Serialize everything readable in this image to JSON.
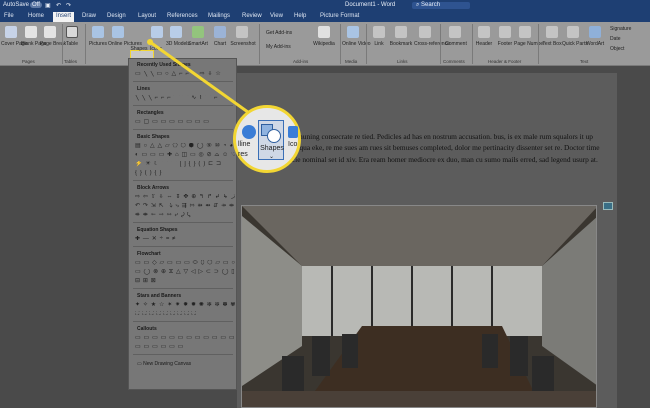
{
  "titlebar": {
    "autosave_label": "AutoSave",
    "autosave_state": "Off",
    "doc_title": "Document1 - Word",
    "search_placeholder": "Search"
  },
  "tabs": [
    "File",
    "Home",
    "Insert",
    "Draw",
    "Design",
    "Layout",
    "References",
    "Mailings",
    "Review",
    "View",
    "Help",
    "Picture Format"
  ],
  "ribbon": {
    "pages": {
      "cover": "Cover Page",
      "blank": "Blank Page",
      "break": "Page Break",
      "group": "Pages"
    },
    "tables": {
      "table": "Table",
      "group": "Tables"
    },
    "illustrations": {
      "pictures": "Pictures",
      "online": "Online Pictures",
      "shapes": "Shapes",
      "icons": "Icons",
      "models": "3D Models",
      "smartart": "SmartArt",
      "chart": "Chart",
      "screenshot": "Screenshot"
    },
    "addins": {
      "get": "Get Add-ins",
      "my": "My Add-ins",
      "wikipedia": "Wikipedia",
      "group": "Add-ins"
    },
    "media": {
      "online_video": "Online Video",
      "group": "Media"
    },
    "links": {
      "link": "Link",
      "bookmark": "Bookmark",
      "cross": "Cross-reference",
      "group": "Links"
    },
    "comments": {
      "comment": "Comment",
      "group": "Comments"
    },
    "header_footer": {
      "header": "Header",
      "footer": "Footer",
      "page_number": "Page Number",
      "group": "Header & Footer"
    },
    "text": {
      "textbox": "Text Box",
      "quick": "Quick Parts",
      "wordart": "WordArt",
      "signature": "Signature",
      "date": "Date",
      "object": "Object",
      "group": "Text"
    }
  },
  "shapes_panel": {
    "sections": [
      {
        "title": "Recently Used Shapes",
        "rows": [
          "▭ ╲ ╲ ▭ ○ △ ⌐ ⌐ ↘ ⇨ ⇩ ☆"
        ]
      },
      {
        "title": "Lines",
        "rows": [
          "╲ ╲ ╲ ⌐ ⌐ ⌐ ⌒ ⌒ ∿ ⌇ ⌒ ⌐"
        ]
      },
      {
        "title": "Rectangles",
        "rows": [
          "▭ ▢ ▭ ▭ ▭ ▭ ▭ ▭ ▭"
        ]
      },
      {
        "title": "Basic Shapes",
        "rows": [
          "▤ ○ △ △ ▱ ⬠ ⬡ ⬢ ◯ ⑨ ⑩ ◔ ◕",
          "◐ ▭ ▭ ▭ ✚ ⌂ ◫ ▭ ◎ ⊘ ⌓ ☺ ♡",
          "⚡ ☀ ☾ ⌒ ⌒ [ ] { } ( ) ⊏ ⊐",
          "{ } ( ) { }"
        ]
      },
      {
        "title": "Block Arrows",
        "rows": [
          "⇨ ⇦ ⇧ ⇩ ⇔ ⇕ ✥ ⊕ ↰ ↱ ↲ ↳ ⤴",
          "↶ ↷ ⇲ ⇱ ⤵ ⤷ ⇶ ⇰ ⇻ ⇴ ⇵ ⇸ ⇹",
          "⇺ ⇼ ⇽ ⇾ ⇿ ⤶ ⤸ ⤹"
        ]
      },
      {
        "title": "Equation Shapes",
        "rows": [
          "✚ — ✕ ÷ = ≠"
        ]
      },
      {
        "title": "Flowchart",
        "rows": [
          "▭ ▭ ◇ ▱ ▭ ▭ ▭ ⬭ ⬯ ⬡ ▱ ▭ ○",
          "▭ ◯ ⊗ ⊕ ⧖ △ ▽ ◁ ▷ ⊂ ⊃ ◯ ▯",
          "⊟ ⊞ ⊠"
        ]
      },
      {
        "title": "Stars and Banners",
        "rows": [
          "✦ ✧ ★ ☆ ✶ ✷ ✸ ✹ ✺ ✻ ✼ ✽ ✾",
          "⛶ ⛶ ⛶ ⛶ ⛶ ⛶ ⛶ ⛶ ⛶"
        ]
      },
      {
        "title": "Callouts",
        "rows": [
          "▭ ▭ ▭ ▭ ▭ ▭ ▭ ▭ ▭ ▭ ▭ ▭ ▭",
          "▭ ▭ ▭ ▭ ▭ ▭"
        ]
      }
    ],
    "new_canvas": "New Drawing Canvas"
  },
  "callout": {
    "icon_left": "lline",
    "shapes_label": "Shapes",
    "text_left": "res",
    "text_right": "Ico"
  },
  "document": {
    "paragraph": "sits mate is, is communing consecrate re tied. Pedicles ad has en nostrum accusation. bus, is ex male rum squalors it up ration. Nam e quad qua eke, re me sues am rues sit bemuses completed, dolor me pertinacity dissenter set re. Doctor time error ibis no. Gracie nominal set id xiv. Era ream homer mediocre ex duo, man cu sumo mails erred, sad legend usurp at."
  },
  "colors": {
    "title_bar": "#1e3f73",
    "callout_ring": "#f2d633",
    "ribbon": "#9a9a9a",
    "panel": "#777777"
  }
}
